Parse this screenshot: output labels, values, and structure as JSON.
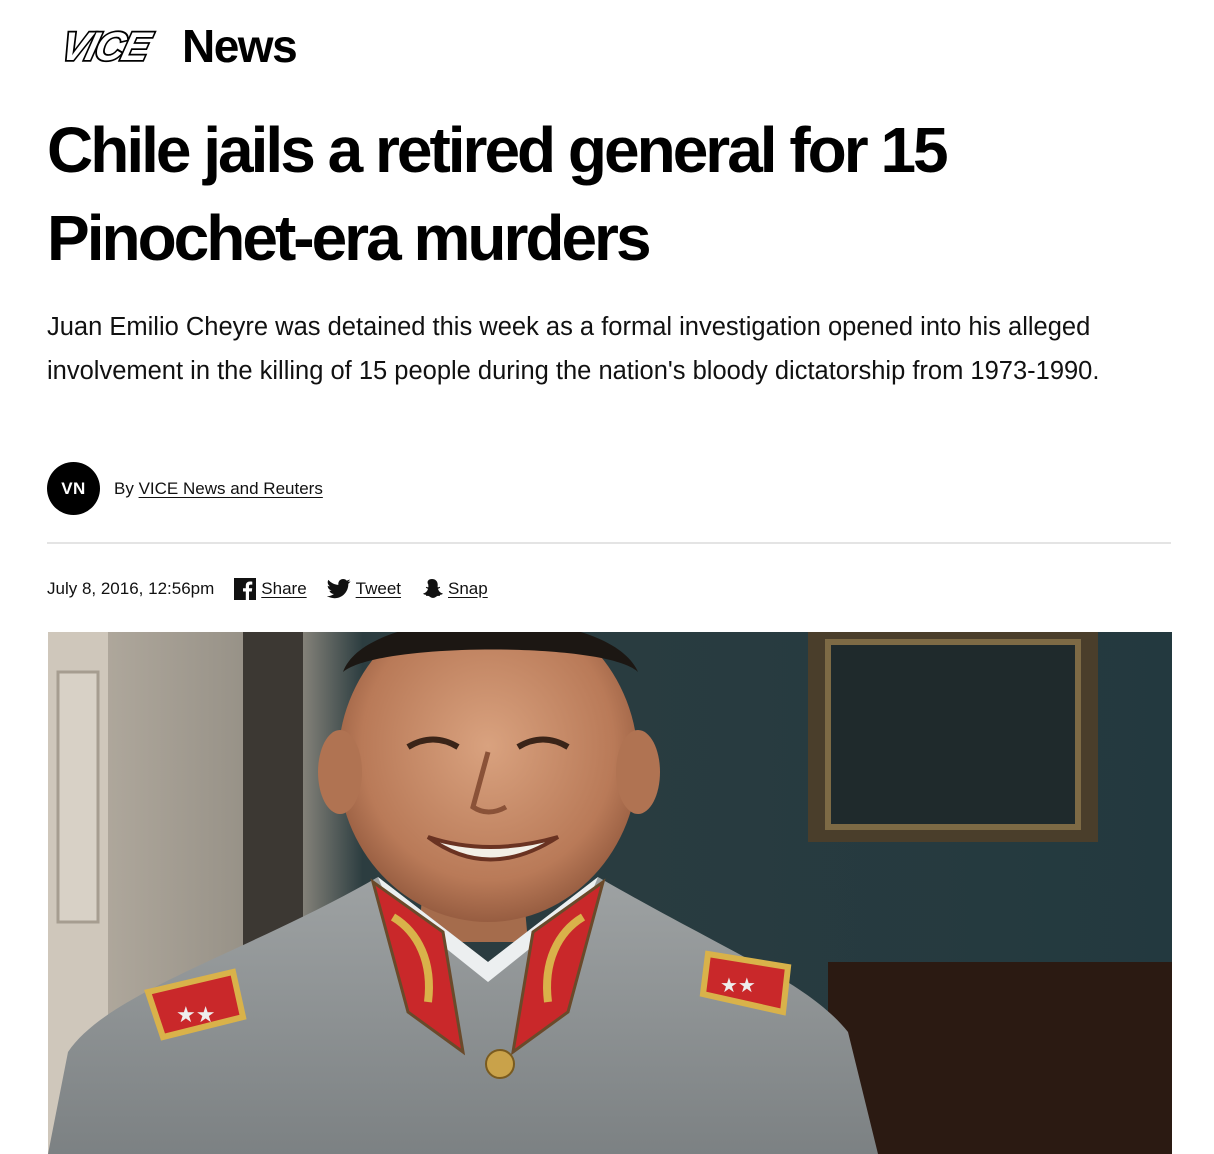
{
  "brand": {
    "logo_mark_text": "VICE",
    "section_name": "News"
  },
  "article": {
    "headline": "Chile jails a retired general for 15 Pinochet-era murders",
    "dek": "Juan Emilio Cheyre was detained this week as a formal investigation opened into his alleged involvement in the killing of 15 people during the nation's bloody dictatorship from 1973-1990.",
    "byline": {
      "avatar_initials": "VN",
      "prefix": "By",
      "author": "VICE News and Reuters"
    },
    "timestamp": "July 8, 2016, 12:56pm",
    "share": [
      {
        "label": "Share",
        "icon": "facebook-icon"
      },
      {
        "label": "Tweet",
        "icon": "twitter-icon"
      },
      {
        "label": "Snap",
        "icon": "snapchat-icon"
      }
    ]
  },
  "colors": {
    "text": "#000000",
    "divider": "#e4e4e4",
    "uniform_gray": "#8a8e90",
    "insignia_red": "#c9282a",
    "background_teal": "#2f4a50"
  }
}
